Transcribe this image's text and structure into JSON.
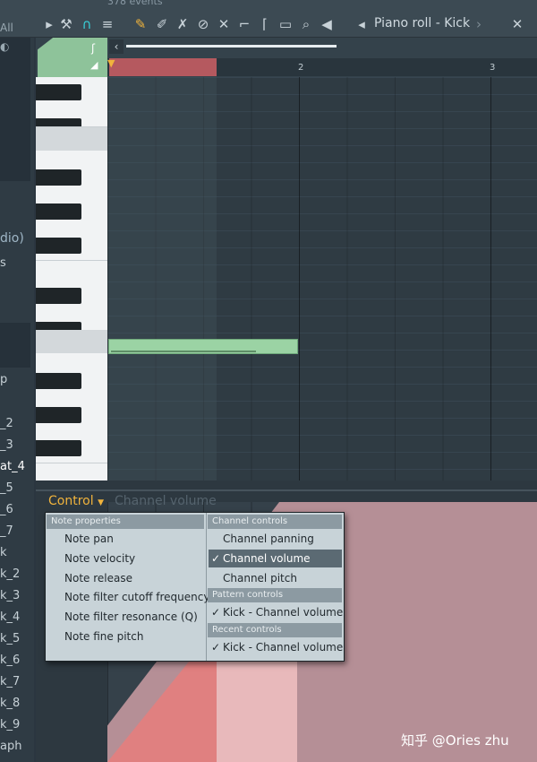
{
  "toolbar": {
    "events_text": "378 events",
    "all_label": "All",
    "title": "Piano roll - Kick"
  },
  "left_strip": {
    "items": [
      "dio)",
      "s",
      "p",
      "_2",
      "_3",
      "at_4",
      "_5",
      "_6",
      "_7",
      "k",
      "k_2",
      "k_3",
      "k_4",
      "k_5",
      "k_6",
      "k_7",
      "k_8",
      "k_9",
      "aph"
    ]
  },
  "ruler": {
    "bar_2": "2",
    "bar_3": "3"
  },
  "control_lane": {
    "dropdown_label": "Control",
    "current_control": "Channel volume"
  },
  "menu": {
    "note_properties_header": "Note properties",
    "note_items": [
      "Note pan",
      "Note velocity",
      "Note release",
      "Note filter cutoff frequency",
      "Note filter resonance (Q)",
      "Note fine pitch"
    ],
    "channel_controls_header": "Channel controls",
    "channel_items": [
      {
        "label": "Channel panning",
        "checked": false
      },
      {
        "label": "Channel volume",
        "checked": true
      },
      {
        "label": "Channel pitch",
        "checked": false
      }
    ],
    "pattern_controls_header": "Pattern controls",
    "pattern_item": "Kick - Channel volume",
    "recent_controls_header": "Recent controls",
    "recent_item": "Kick - Channel volume",
    "check_glyph": "✓"
  },
  "watermark": "知乎 @Ories zhu",
  "colors": {
    "note": "#9bd3a4",
    "loop": "#b5595f",
    "control_accent": "#f0b33c",
    "menu_bg": "#c8d3d8",
    "selected": "#5b6a73"
  }
}
